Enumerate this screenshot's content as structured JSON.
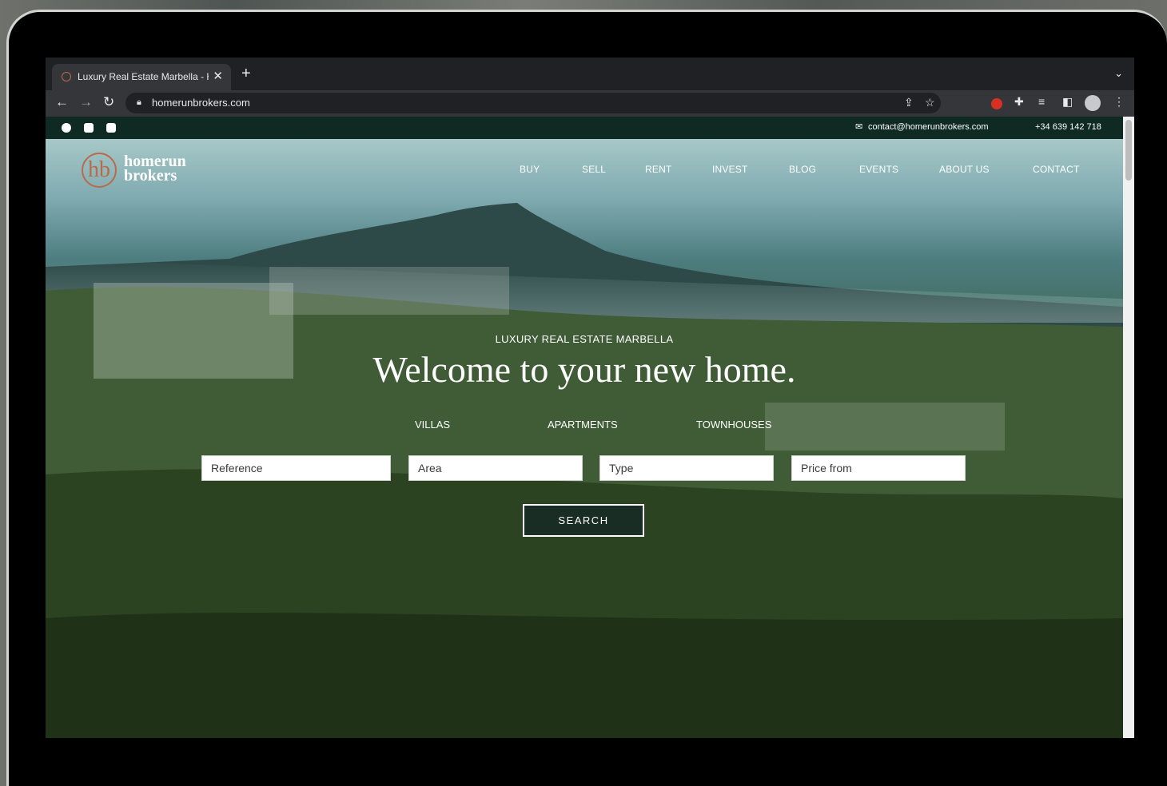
{
  "browser": {
    "tab_title": "Luxury Real Estate Marbella - H",
    "tab_close": "✕",
    "new_tab": "+",
    "tab_menu": "⌄",
    "url": "homerunbrokers.com"
  },
  "site": {
    "topbar": {
      "email": "contact@homerunbrokers.com",
      "phone": "+34 639 142 718"
    },
    "logo": {
      "mark": "hb",
      "line1": "homerun",
      "line2": "brokers",
      "color": "#b86a4a"
    },
    "nav": {
      "buy": "BUY",
      "sell": "SELL",
      "rent": "RENT",
      "invest": "INVEST",
      "blog": "BLOG",
      "events": "EVENTS",
      "about": "ABOUT US",
      "contact": "CONTACT"
    },
    "hero": {
      "eyebrow": "LUXURY REAL ESTATE MARBELLA",
      "headline": "Welcome to your new home.",
      "categories": {
        "villas": "VILLAS",
        "apartments": "APARTMENTS",
        "townhouses": "TOWNHOUSES"
      },
      "search": {
        "reference_placeholder": "Reference",
        "area_placeholder": "Area",
        "type_placeholder": "Type",
        "price_placeholder": "Price from",
        "button": "SEARCH"
      }
    },
    "colors": {
      "brand_dark": "#0f2a22",
      "accent": "#b86a4a"
    }
  }
}
